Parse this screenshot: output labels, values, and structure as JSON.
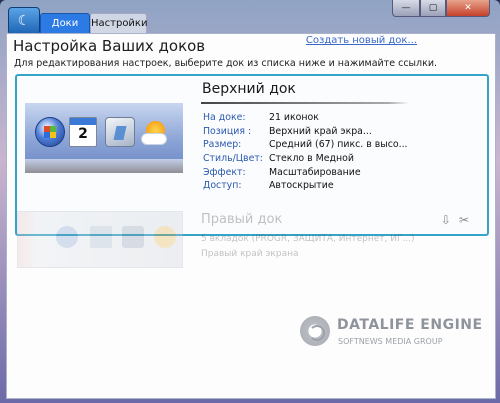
{
  "titlebar": {
    "app_icon_glyph": "☾",
    "tabs": [
      {
        "label": "Доки",
        "active": true
      },
      {
        "label": "Настройки",
        "active": false
      }
    ],
    "min_glyph": "—",
    "max_glyph": "▢",
    "close_glyph": "✕"
  },
  "page": {
    "title": "Настройка Ваших доков",
    "create_link": "Создать новый док...",
    "instructions": "Для редактирования настроек, выберите док из списка ниже и нажимайте ссылки."
  },
  "selected_dock": {
    "name": "Верхний док",
    "calendar_day": "2",
    "properties": [
      {
        "label": "На доке:",
        "value": "21 иконок"
      },
      {
        "label": "Позиция :",
        "value": "Верхний край экра..."
      },
      {
        "label": "Размер:",
        "value": "Средний (67) пикс. в высо..."
      },
      {
        "label": "Стиль/Цвет:",
        "value": "Стекло в Медной"
      },
      {
        "label": "Эффект:",
        "value": "Масштабирование"
      },
      {
        "label": "Доступ:",
        "value": "Автоскрытие"
      }
    ],
    "export_icon": "⇩",
    "tools_icon": "✂"
  },
  "other_dock": {
    "name": "Правый док",
    "line1": "5 вкладок (PROGR, ЗАЩИТА, Интернет, ИГ...)",
    "line2": "Правый край экрана"
  },
  "watermark": {
    "title": "DATALIFE ENGINE",
    "subtitle": "SOFTNEWS MEDIA GROUP"
  }
}
